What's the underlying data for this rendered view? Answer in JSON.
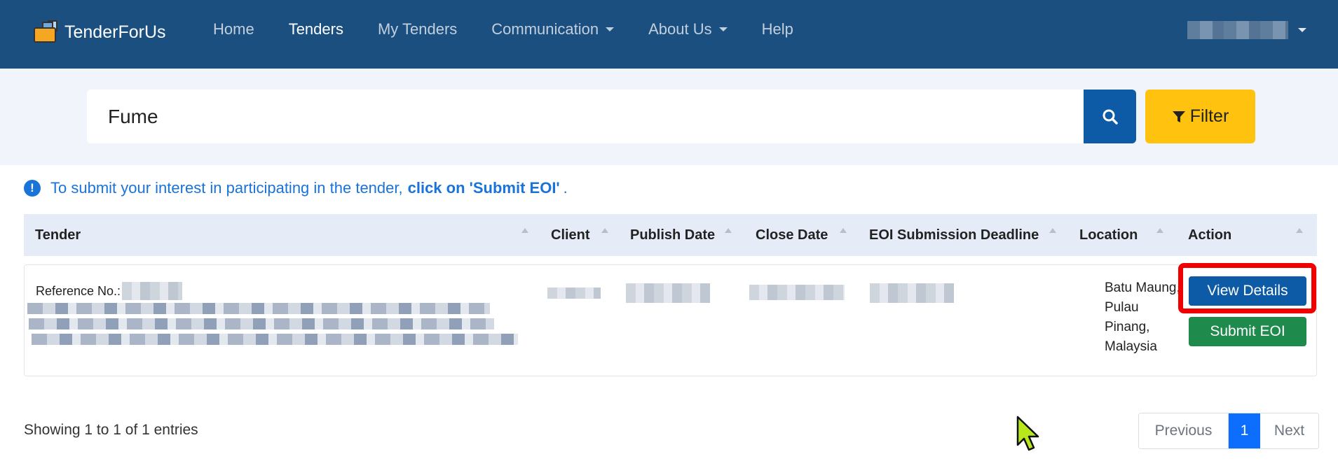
{
  "navbar": {
    "brand": "TenderForUs",
    "items": [
      {
        "label": "Home",
        "active": false,
        "dropdown": false
      },
      {
        "label": "Tenders",
        "active": true,
        "dropdown": false
      },
      {
        "label": "My Tenders",
        "active": false,
        "dropdown": false
      },
      {
        "label": "Communication",
        "active": false,
        "dropdown": true
      },
      {
        "label": "About Us",
        "active": false,
        "dropdown": true
      },
      {
        "label": "Help",
        "active": false,
        "dropdown": false
      }
    ]
  },
  "search": {
    "value": "Fume",
    "filter_label": "Filter"
  },
  "info": {
    "text": "To submit your interest in participating in the tender,",
    "bold": "click on 'Submit EOI'",
    "end": "."
  },
  "table": {
    "columns": [
      "Tender",
      "Client",
      "Publish Date",
      "Close Date",
      "EOI Submission Deadline",
      "Location",
      "Action"
    ],
    "rows": [
      {
        "reference_label": "Reference No.:",
        "location": [
          "Batu Maung,",
          "Pulau",
          "Pinang,",
          "Malaysia"
        ],
        "view_label": "View Details",
        "eoi_label": "Submit EOI"
      }
    ]
  },
  "footer": {
    "showing": "Showing 1 to 1 of 1 entries",
    "previous": "Previous",
    "current_page": "1",
    "next": "Next"
  },
  "colors": {
    "navbar": "#1b4f80",
    "primary": "#0d5ba6",
    "warning": "#ffc20e",
    "success": "#1e8a4c",
    "highlight": "#f00000"
  }
}
